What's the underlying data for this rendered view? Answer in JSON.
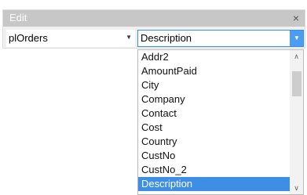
{
  "panel": {
    "title": "Edit",
    "close_glyph": "×"
  },
  "left_combo": {
    "value": "plOrders",
    "arrow_glyph": "▼"
  },
  "right_combo": {
    "value": "Description",
    "arrow_glyph": "▼"
  },
  "dropdown": {
    "items": [
      "Addr2",
      "AmountPaid",
      "City",
      "Company",
      "Contact",
      "Cost",
      "Country",
      "CustNo",
      "CustNo_2",
      "Description"
    ],
    "selected": "Description",
    "scroll_up_glyph": "∧",
    "scroll_down_glyph": "∨"
  },
  "colors": {
    "title_bar": "#c7c7c7",
    "selection": "#3f8ee6",
    "focus_border": "#3a8ee6"
  },
  "icons": {
    "close": "close-icon",
    "dropdown_arrow": "chevron-down-icon",
    "scroll_up": "chevron-up-icon",
    "scroll_down": "chevron-down-icon"
  }
}
